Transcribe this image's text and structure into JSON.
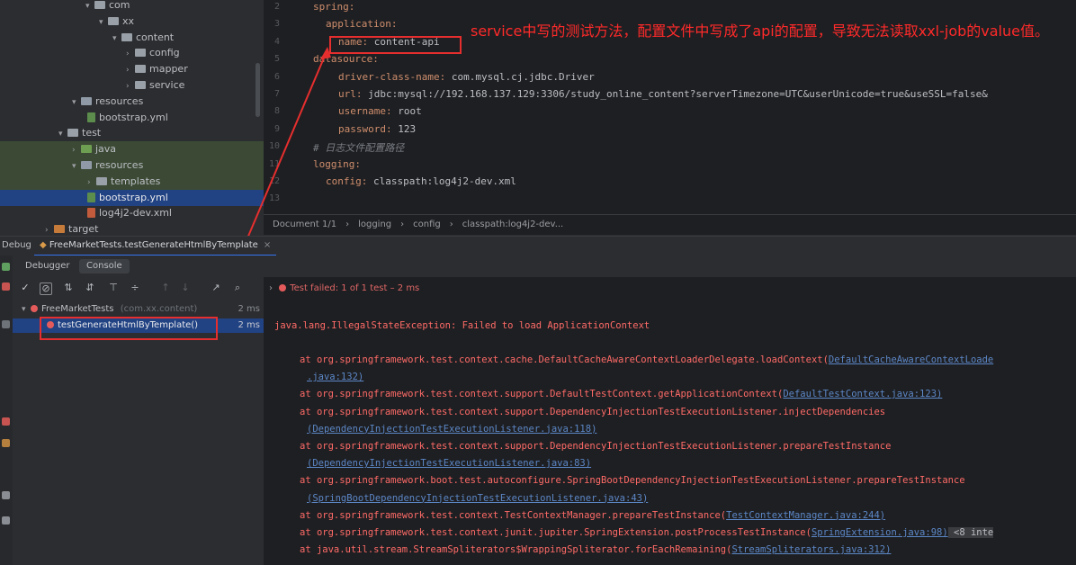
{
  "project_tree": [
    {
      "label": "com",
      "indent": 95,
      "arrow": "▾",
      "icon": "gray"
    },
    {
      "label": "xx",
      "indent": 110,
      "arrow": "▾",
      "icon": "gray"
    },
    {
      "label": "content",
      "indent": 125,
      "arrow": "▾",
      "icon": "gray"
    },
    {
      "label": "config",
      "indent": 140,
      "arrow": "›",
      "icon": "gray"
    },
    {
      "label": "mapper",
      "indent": 140,
      "arrow": "›",
      "icon": "gray"
    },
    {
      "label": "service",
      "indent": 140,
      "arrow": "›",
      "icon": "gray"
    },
    {
      "label": "resources",
      "indent": 80,
      "arrow": "▾",
      "icon": "res"
    },
    {
      "label": "bootstrap.yml",
      "indent": 97,
      "arrow": "",
      "icon": "yaml"
    },
    {
      "label": "test",
      "indent": 65,
      "arrow": "▾",
      "icon": "gray"
    },
    {
      "label": "java",
      "indent": 80,
      "arrow": "›",
      "icon": "green",
      "hl": true
    },
    {
      "label": "resources",
      "indent": 80,
      "arrow": "▾",
      "icon": "res",
      "hl": true
    },
    {
      "label": "templates",
      "indent": 97,
      "arrow": "›",
      "icon": "gray",
      "hl": true
    },
    {
      "label": "bootstrap.yml",
      "indent": 97,
      "arrow": "",
      "icon": "yaml",
      "sel": true
    },
    {
      "label": "log4j2-dev.xml",
      "indent": 97,
      "arrow": "",
      "icon": "xml"
    },
    {
      "label": "target",
      "indent": 50,
      "arrow": "›",
      "icon": "orange"
    }
  ],
  "editor": {
    "line_numbers": [
      "2",
      "3",
      "4",
      "5",
      "6",
      "7",
      "8",
      "9",
      "10",
      "11",
      "12",
      "13"
    ],
    "lines": [
      {
        "indent": 0,
        "parts": [
          {
            "t": "spring:",
            "c": "k"
          }
        ]
      },
      {
        "indent": 1,
        "parts": [
          {
            "t": "application:",
            "c": "k"
          }
        ]
      },
      {
        "indent": 2,
        "parts": [
          {
            "t": "name: ",
            "c": "k"
          },
          {
            "t": "content-api",
            "c": "p"
          }
        ]
      },
      {
        "indent": 0,
        "parts": [
          {
            "t": "datasource:",
            "c": "k"
          }
        ]
      },
      {
        "indent": 2,
        "parts": [
          {
            "t": "driver-class-name: ",
            "c": "k"
          },
          {
            "t": "com.mysql.cj.jdbc.Driver",
            "c": "p"
          }
        ]
      },
      {
        "indent": 2,
        "parts": [
          {
            "t": "url: ",
            "c": "k"
          },
          {
            "t": "jdbc:mysql://192.168.137.129:3306/study_online_content?serverTimezone=UTC&userUnicode=true&useSSL=false&",
            "c": "p"
          }
        ]
      },
      {
        "indent": 2,
        "parts": [
          {
            "t": "username: ",
            "c": "k"
          },
          {
            "t": "root",
            "c": "p"
          }
        ]
      },
      {
        "indent": 2,
        "parts": [
          {
            "t": "password: ",
            "c": "k"
          },
          {
            "t": "123",
            "c": "p"
          }
        ]
      },
      {
        "indent": 0,
        "parts": [
          {
            "t": "# 日志文件配置路径",
            "c": "c"
          }
        ]
      },
      {
        "indent": 0,
        "parts": [
          {
            "t": "logging:",
            "c": "k"
          }
        ]
      },
      {
        "indent": 1,
        "parts": [
          {
            "t": "config: ",
            "c": "k"
          },
          {
            "t": "classpath:log4j2-dev.xml",
            "c": "p"
          }
        ]
      },
      {
        "indent": 0,
        "parts": []
      }
    ],
    "annotation": "service中写的测试方法，配置文件中写成了api的配置，导致无法读取xxl-job的value值。"
  },
  "breadcrumb": [
    "Document 1/1",
    "›",
    "logging",
    "›",
    "config",
    "›",
    "classpath:log4j2-dev..."
  ],
  "debug": {
    "bar_label": "Debug",
    "run_tab": "FreeMarketTests.testGenerateHtmlByTemplate",
    "subtabs": [
      "Debugger",
      "Console"
    ],
    "tree_root": "FreeMarketTests",
    "tree_root_pkg": "(com.xx.content)",
    "tree_root_time": "2 ms",
    "test_method": "testGenerateHtmlByTemplate()",
    "test_time": "2 ms",
    "status": "Test failed: 1 of 1 test – 2 ms",
    "console": [
      {
        "t": "java.lang.IllegalStateException: Failed to load ApplicationContext",
        "indent": 0
      },
      {
        "t": "at org.springframework.test.context.cache.DefaultCacheAwareContextLoaderDelegate.loadContext(",
        "indent": 1,
        "link": "DefaultCacheAwareContextLoade"
      },
      {
        "t": "",
        "indent": 2,
        "link": ".java:132)"
      },
      {
        "t": "at org.springframework.test.context.support.DefaultTestContext.getApplicationContext(",
        "indent": 1,
        "link": "DefaultTestContext.java:123)"
      },
      {
        "t": "at org.springframework.test.context.support.DependencyInjectionTestExecutionListener.injectDependencies",
        "indent": 1
      },
      {
        "t": "",
        "indent": 2,
        "link": "(DependencyInjectionTestExecutionListener.java:118)"
      },
      {
        "t": "at org.springframework.test.context.support.DependencyInjectionTestExecutionListener.prepareTestInstance",
        "indent": 1
      },
      {
        "t": "",
        "indent": 2,
        "link": "(DependencyInjectionTestExecutionListener.java:83)"
      },
      {
        "t": "at org.springframework.boot.test.autoconfigure.SpringBootDependencyInjectionTestExecutionListener.prepareTestInstance",
        "indent": 1
      },
      {
        "t": "",
        "indent": 2,
        "link": "(SpringBootDependencyInjectionTestExecutionListener.java:43)"
      },
      {
        "t": "at org.springframework.test.context.TestContextManager.prepareTestInstance(",
        "indent": 1,
        "link": "TestContextManager.java:244)"
      },
      {
        "t": "at org.springframework.test.context.junit.jupiter.SpringExtension.postProcessTestInstance(",
        "indent": 1,
        "link": "SpringExtension.java:98)",
        "tail": " <8 inte"
      },
      {
        "t": "at java.util.stream.StreamSpliterators$WrappingSpliterator.forEachRemaining(",
        "indent": 1,
        "link": "StreamSpliterators.java:312)"
      }
    ]
  },
  "colors": {
    "accent": "#3574f0",
    "error": "#ff6b68",
    "annotation": "#ff2a2a"
  }
}
